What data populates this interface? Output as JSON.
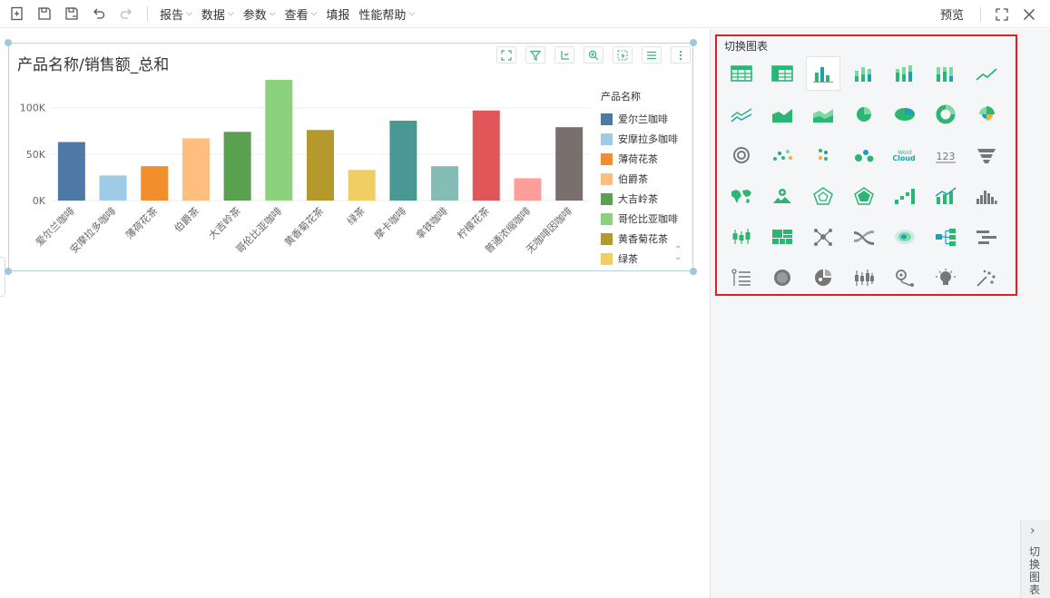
{
  "toolbar": {
    "menus": [
      {
        "label": "报告"
      },
      {
        "label": "数据"
      },
      {
        "label": "参数"
      },
      {
        "label": "查看"
      },
      {
        "label": "填报",
        "plain": true
      },
      {
        "label": "性能帮助"
      }
    ],
    "preview_label": "预览"
  },
  "widget": {
    "title": "产品名称/销售额_总和",
    "legend_title": "产品名称",
    "legend_items": [
      {
        "name": "爱尔兰咖啡",
        "color": "#4e79a7"
      },
      {
        "name": "安摩拉多咖啡",
        "color": "#a0cbe8"
      },
      {
        "name": "薄荷花茶",
        "color": "#f28e2b"
      },
      {
        "name": "伯爵茶",
        "color": "#ffbe7d"
      },
      {
        "name": "大吉岭茶",
        "color": "#59a14f"
      },
      {
        "name": "哥伦比亚咖啡",
        "color": "#8cd17d"
      },
      {
        "name": "黄香菊花茶",
        "color": "#b6992d"
      },
      {
        "name": "绿茶",
        "color": "#f1ce63"
      }
    ]
  },
  "chart_data": {
    "type": "bar",
    "title": "产品名称/销售额_总和",
    "xlabel": "",
    "ylabel": "",
    "ylim": [
      0,
      130000
    ],
    "yticks": [
      0,
      50000,
      100000
    ],
    "ytick_labels": [
      "0K",
      "50K",
      "100K"
    ],
    "categories": [
      "爱尔兰咖啡",
      "安摩拉多咖啡",
      "薄荷花茶",
      "伯爵茶",
      "大吉岭茶",
      "哥伦比亚咖啡",
      "黄香菊花茶",
      "绿茶",
      "摩卡咖啡",
      "拿铁咖啡",
      "柠檬花茶",
      "普通浓缩咖啡",
      "无咖啡因咖啡"
    ],
    "values": [
      63000,
      27000,
      37000,
      67000,
      74000,
      130000,
      76000,
      33000,
      86000,
      37000,
      97000,
      24000,
      79000
    ],
    "colors": [
      "#4e79a7",
      "#a0cbe8",
      "#f28e2b",
      "#ffbe7d",
      "#59a14f",
      "#8cd17d",
      "#b6992d",
      "#f1ce63",
      "#499894",
      "#86bcb6",
      "#e15759",
      "#ff9d9a",
      "#79706e"
    ],
    "grid": true,
    "legend": "right"
  },
  "right_panel": {
    "title": "切换图表",
    "collapse_label": "切换图表",
    "chart_types": [
      "table-icon",
      "crosstable-icon",
      "bar-chart-icon",
      "stacked-bar-icon",
      "percent-stacked-bar-icon",
      "combo-stacked-bar-icon",
      "line-chart-icon",
      "multi-line-icon",
      "area-chart-icon",
      "stacked-area-icon",
      "pie-chart-icon",
      "ellipse-pie-icon",
      "donut-chart-icon",
      "rose-pie-icon",
      "concentric-ring-icon",
      "scatter-icon",
      "dot-scatter-icon",
      "bubble-icon",
      "word-cloud-icon",
      "kpi-number-icon",
      "funnel-icon",
      "world-map-icon",
      "location-map-icon",
      "radar-icon",
      "filled-radar-icon",
      "waterfall-icon",
      "bar-line-combo-icon",
      "histogram-icon",
      "boxplot-icon",
      "treemap-icon",
      "network-icon",
      "sankey-icon",
      "heatmap-icon",
      "tree-icon",
      "gantt-icon",
      "indicator-list-icon",
      "gauge-icon",
      "pie-map-icon",
      "candlestick-icon",
      "route-map-icon",
      "bulb-icon",
      "magic-icon"
    ],
    "selected_index": 2
  }
}
